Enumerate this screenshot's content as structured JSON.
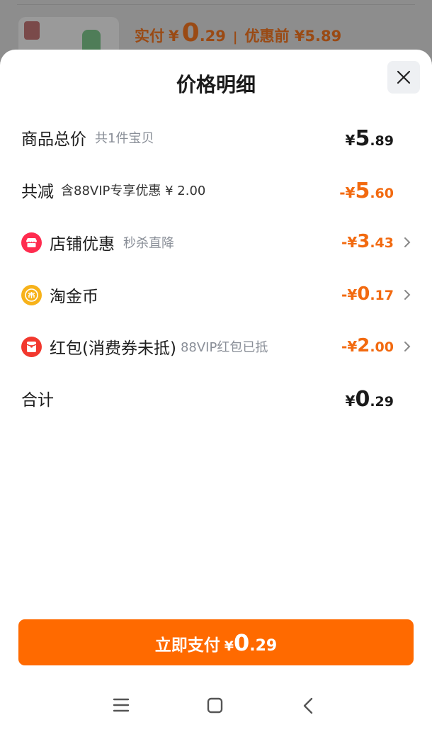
{
  "background": {
    "actual_pay_label": "实付",
    "actual_pay_yen": "¥",
    "actual_pay_int": "0",
    "actual_pay_dec": ".29",
    "separator": "|",
    "before_discount": "优惠前 ¥5.89"
  },
  "sheet": {
    "title": "价格明细",
    "close_icon": "close-icon",
    "rows": [
      {
        "label": "商品总价",
        "sub": "共1件宝贝",
        "yen": "¥",
        "int": "5",
        "dec": ".89"
      },
      {
        "label": "共减",
        "sub": "含88VIP专享优惠 ¥ 2.00",
        "yen": "-¥",
        "int": "5",
        "dec": ".60"
      },
      {
        "label": "店铺优惠",
        "sub": "秒杀直降",
        "yen": "-¥",
        "int": "3",
        "dec": ".43",
        "icon": "shop-icon"
      },
      {
        "label": "淘金币",
        "sub": "",
        "yen": "-¥",
        "int": "0",
        "dec": ".17",
        "icon": "coin-icon"
      },
      {
        "label": "红包(消费券未抵)",
        "sub": "88VIP红包已抵",
        "yen": "-¥",
        "int": "2",
        "dec": ".00",
        "icon": "red-packet-icon"
      },
      {
        "label": "合计",
        "sub": "",
        "yen": "¥",
        "int": "0",
        "dec": ".29"
      }
    ]
  },
  "pay_button": {
    "label": "立即支付",
    "yen": "¥",
    "int": "0",
    "dec": ".29"
  },
  "colors": {
    "accent": "#ff6a00",
    "discount": "#f26a10",
    "shop_icon": "#ff2c4f",
    "coin_icon": "#f7b21a",
    "packet_icon": "#f2382e"
  },
  "navbar": {
    "icons": [
      "menu-icon",
      "home-icon",
      "back-icon"
    ]
  }
}
